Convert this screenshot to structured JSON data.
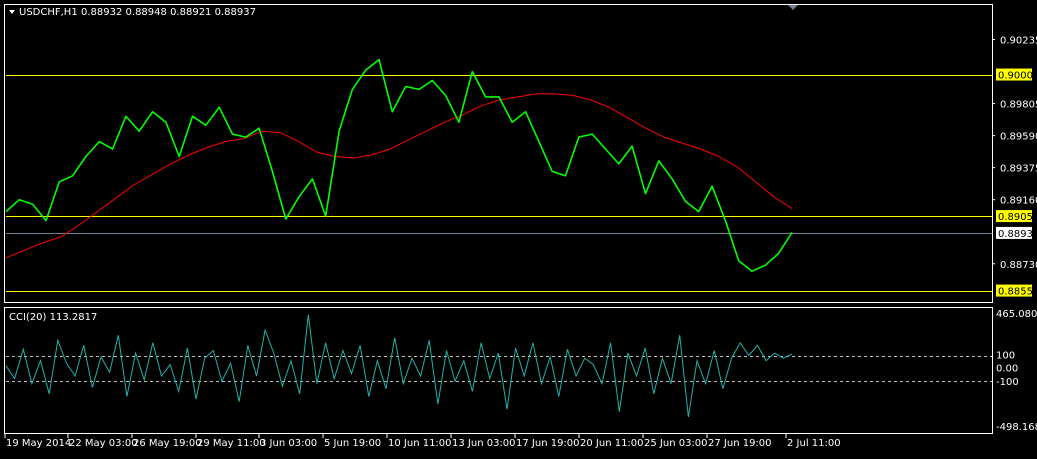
{
  "header": {
    "symbol": "USDCHF,H1",
    "ohlc": "0.88932 0.88948 0.88921 0.88937",
    "menu_icon": "triangle-down-icon"
  },
  "indicator_header": "CCI(20) 113.2817",
  "colors": {
    "background": "#000000",
    "frame": "#ffffff",
    "price": "#00ff00",
    "ma": "#ff0000",
    "level_line": "#ffff00",
    "current_line": "#708090",
    "cci": "#20b2aa",
    "cci_levels": "#c0c0c0"
  },
  "chart_data": [
    {
      "type": "line",
      "title": "USDCHF,H1",
      "xlabel": "",
      "ylabel": "",
      "ylim": [
        0.8848,
        0.9046
      ],
      "grid": false,
      "categories": [
        "19 May 2014",
        "22 May 03:00",
        "26 May 19:00",
        "29 May 11:00",
        "3 Jun 03:00",
        "5 Jun 19:00",
        "10 Jun 11:00",
        "13 Jun 03:00",
        "17 Jun 19:00",
        "20 Jun 11:00",
        "25 Jun 03:00",
        "27 Jun 19:00",
        "2 Jul 11:00"
      ],
      "y_ticks": [
        "0.90235",
        "0.89805",
        "0.89590",
        "0.89375",
        "0.89160",
        "0.88730"
      ],
      "series": [
        {
          "name": "",
          "color": "#00ff00",
          "values": [
            0.8908,
            0.8916,
            0.8913,
            0.8902,
            0.8928,
            0.8932,
            0.8945,
            0.8955,
            0.895,
            0.8972,
            0.8962,
            0.8975,
            0.8968,
            0.8945,
            0.8972,
            0.8966,
            0.8978,
            0.896,
            0.8958,
            0.8964,
            0.8935,
            0.8903,
            0.8918,
            0.893,
            0.8905,
            0.8962,
            0.899,
            0.9003,
            0.901,
            0.8975,
            0.8992,
            0.899,
            0.8996,
            0.8986,
            0.8968,
            0.9002,
            0.8985,
            0.8985,
            0.8968,
            0.8975,
            0.8955,
            0.8935,
            0.8932,
            0.8958,
            0.896,
            0.895,
            0.894,
            0.8952,
            0.892,
            0.8942,
            0.893,
            0.8915,
            0.8908,
            0.8925,
            0.8902,
            0.8875,
            0.8868,
            0.8872,
            0.888,
            0.8894
          ]
        },
        {
          "name": "",
          "color": "#ff0000",
          "values": [
            0.8877,
            0.8882,
            0.8887,
            0.8891,
            0.8899,
            0.8908,
            0.8917,
            0.8926,
            0.8933,
            0.894,
            0.8946,
            0.8951,
            0.8955,
            0.8957,
            0.8962,
            0.8961,
            0.8955,
            0.8948,
            0.8945,
            0.8944,
            0.8946,
            0.895,
            0.8956,
            0.8962,
            0.8968,
            0.8973,
            0.8979,
            0.8983,
            0.8985,
            0.8987,
            0.8987,
            0.8986,
            0.8983,
            0.8978,
            0.8971,
            0.8964,
            0.8958,
            0.8954,
            0.895,
            0.8945,
            0.8938,
            0.8928,
            0.8918,
            0.891
          ]
        }
      ],
      "horizontal_levels": [
        {
          "value": 0.9,
          "label": "0.90000",
          "color": "#ffff00"
        },
        {
          "value": 0.8905,
          "label": "0.89050",
          "color": "#ffff00"
        },
        {
          "value": 0.88937,
          "label": "0.88937",
          "color": "#708090"
        },
        {
          "value": 0.8855,
          "label": "0.88550",
          "color": "#ffff00"
        }
      ]
    },
    {
      "type": "line",
      "title": "CCI(20) 113.2817",
      "xlabel": "",
      "ylabel": "",
      "ylim": [
        -498.1682,
        465.0803
      ],
      "grid": false,
      "y_ticks": [
        "465.0803",
        "100",
        "0.00",
        "-100",
        "-498.1682"
      ],
      "levels": [
        100,
        -100
      ],
      "series": [
        {
          "name": "",
          "color": "#20b2aa",
          "values": [
            20,
            -80,
            150,
            -120,
            60,
            -200,
            220,
            40,
            -60,
            180,
            -150,
            90,
            -30,
            260,
            -220,
            120,
            -90,
            200,
            -60,
            30,
            -180,
            160,
            -240,
            80,
            140,
            -100,
            40,
            -260,
            180,
            -60,
            300,
            120,
            -140,
            60,
            -200,
            420,
            -120,
            200,
            -80,
            140,
            -40,
            180,
            -220,
            60,
            -160,
            240,
            -120,
            80,
            -60,
            220,
            -280,
            140,
            -100,
            60,
            -180,
            200,
            -80,
            120,
            -320,
            160,
            -60,
            200,
            -120,
            90,
            -220,
            150,
            -60,
            80,
            30,
            -120,
            200,
            -340,
            120,
            -60,
            160,
            -200,
            80,
            -120,
            260,
            -380,
            60,
            -120,
            140,
            -160,
            80,
            200,
            100,
            180,
            60,
            120,
            80,
            113
          ]
        }
      ]
    }
  ]
}
